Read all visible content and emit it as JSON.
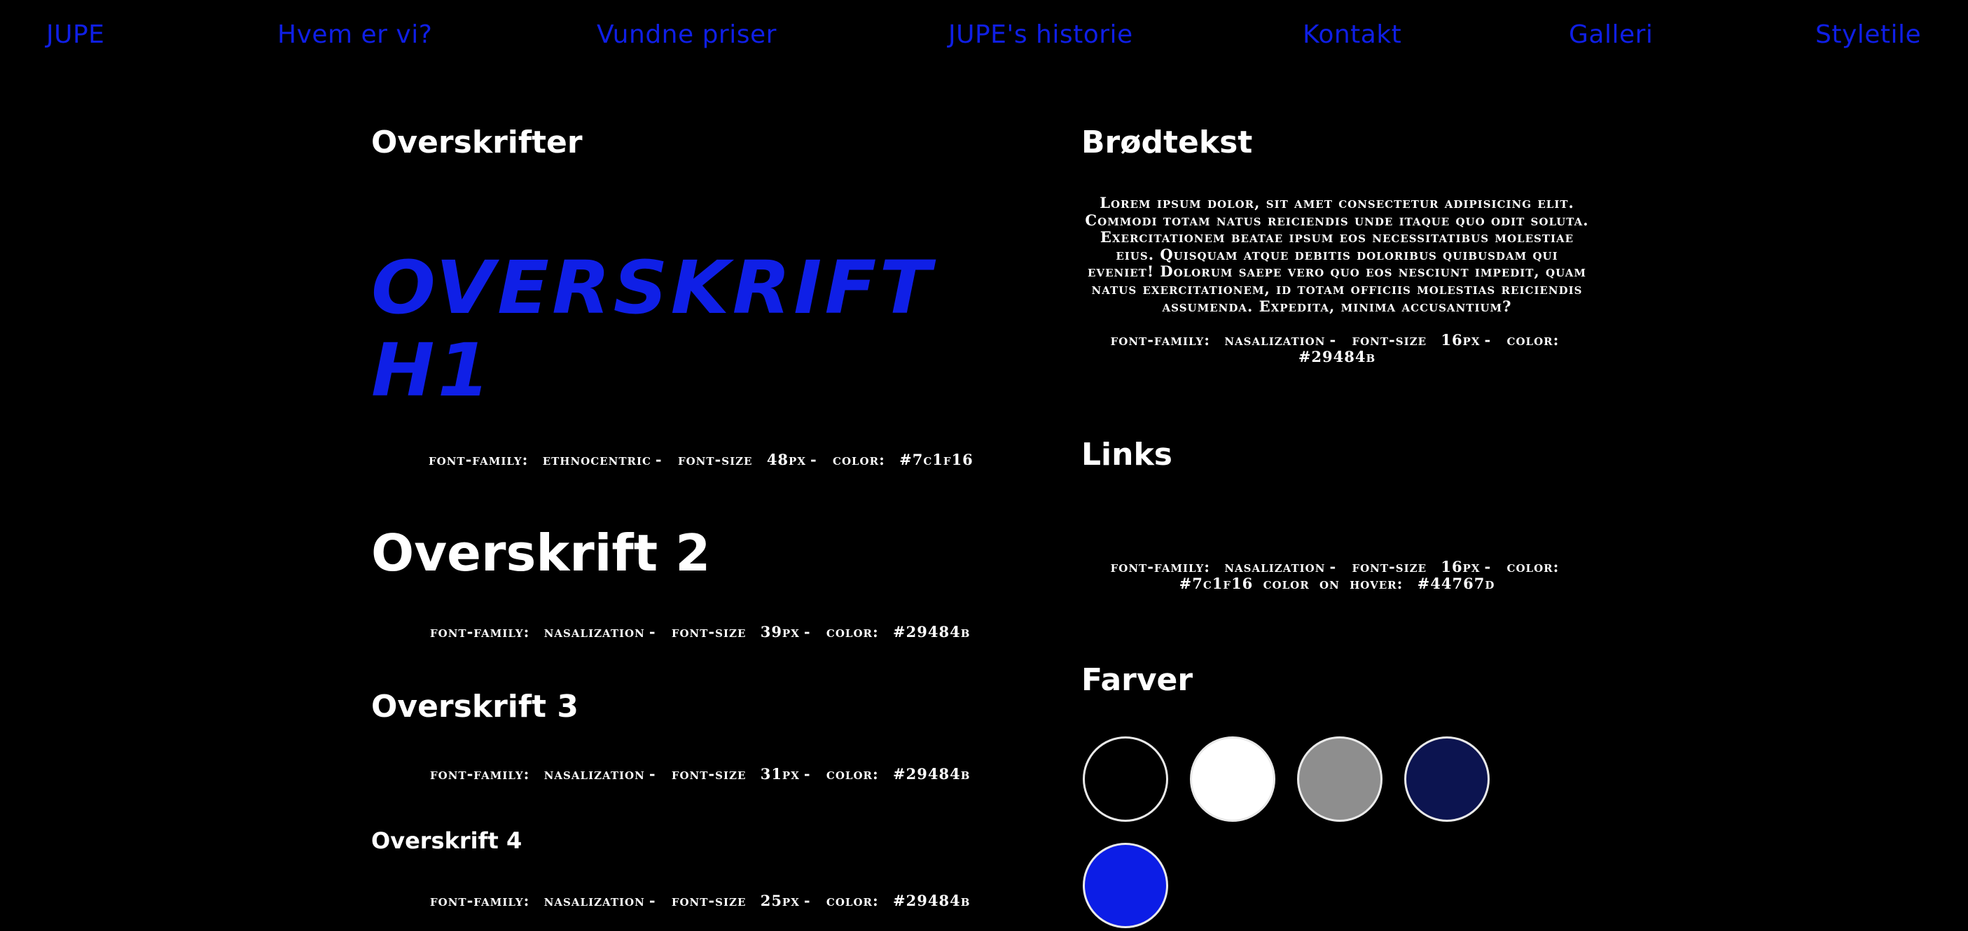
{
  "nav": {
    "items": [
      {
        "label": "JUPE"
      },
      {
        "label": "Hvem er vi?"
      },
      {
        "label": "Vundne priser"
      },
      {
        "label": "JUPE's historie"
      },
      {
        "label": "Kontakt"
      },
      {
        "label": "Galleri"
      },
      {
        "label": "Styletile"
      }
    ],
    "color": "#0f1fe6"
  },
  "left": {
    "section_title": "Overskrifter",
    "h1": {
      "text": "OVERSKRIFT H1",
      "line1": "OVERSKRIFT",
      "line2": "H1",
      "specs": {
        "k1": "FONT-FAMILY:",
        "v1": "ETHNOCENTRIC",
        "k2": "FONT-SIZE",
        "v2": "48PX",
        "k3": "COLOR:",
        "v3": "#7C1F16"
      }
    },
    "h2": {
      "text": "Overskrift 2",
      "specs": {
        "k1": "FONT-FAMILY:",
        "v1": "NASALIZATION",
        "k2": "FONT-SIZE",
        "v2": "39PX",
        "k3": "COLOR:",
        "v3": "#29484B"
      }
    },
    "h3": {
      "text": "Overskrift 3",
      "specs": {
        "k1": "FONT-FAMILY:",
        "v1": "NASALIZATION",
        "k2": "FONT-SIZE",
        "v2": "31PX",
        "k3": "COLOR:",
        "v3": "#29484B"
      }
    },
    "h4": {
      "text": "Overskrift 4",
      "specs": {
        "k1": "FONT-FAMILY:",
        "v1": "NASALIZATION",
        "k2": "FONT-SIZE",
        "v2": "25PX",
        "k3": "COLOR:",
        "v3": "#29484B"
      }
    }
  },
  "right": {
    "body_title": "Brødtekst",
    "body_text": "Lorem ipsum dolor, sit amet consectetur adipisicing elit. Commodi totam natus reiciendis unde itaque quo odit soluta. Exercitationem beatae ipsum eos necessitatibus molestiae eius. Quisquam atque debitis doloribus quibusdam qui eveniet! Dolorum saepe vero quo eos nesciunt impedit, quam natus exercitationem, id totam officiis molestias reiciendis assumenda. Expedita, minima accusantium?",
    "body_specs": {
      "k1": "FONT-FAMILY:",
      "v1": "NASALIZATION",
      "k2": "FONT-SIZE",
      "v2": "16PX",
      "k3": "COLOR:",
      "v3": "#29484B"
    },
    "links_title": "Links",
    "links_specs": {
      "k1": "FONT-FAMILY:",
      "v1": "NASALIZATION",
      "k2": "FONT-SIZE",
      "v2": "16PX",
      "k3": "COLOR:",
      "v3": "#7C1F16",
      "k4": "COLOR ON HOVER:",
      "v4": "#44767D"
    },
    "colors_title": "Farver",
    "swatches": [
      "#000000",
      "#ffffff",
      "#8e8e8e",
      "#0c1450",
      "#0c1de6"
    ]
  }
}
